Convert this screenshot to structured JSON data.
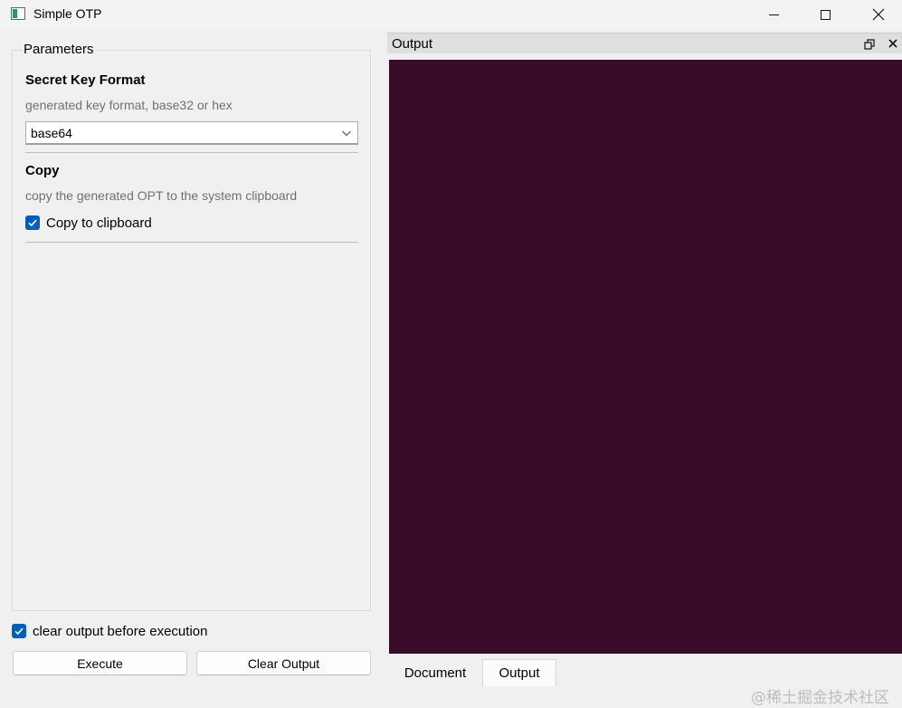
{
  "window": {
    "title": "Simple OTP"
  },
  "parameters": {
    "group_title": "Parameters",
    "secret_key": {
      "title": "Secret Key Format",
      "description": "generated key format, base32 or hex",
      "selected": "base64"
    },
    "copy": {
      "title": "Copy",
      "description": "copy the generated OPT to the system clipboard",
      "checkbox_label": "Copy to clipboard",
      "checked": true
    }
  },
  "clear_before": {
    "label": "clear output before execution",
    "checked": true
  },
  "buttons": {
    "execute": "Execute",
    "clear_output": "Clear Output"
  },
  "output_dock": {
    "title": "Output",
    "background": "#3b0c29",
    "tabs": [
      {
        "label": "Document"
      },
      {
        "label": "Output",
        "active": true
      }
    ]
  },
  "watermark": "@稀土掘金技术社区",
  "colors": {
    "accent": "#005fb8"
  }
}
